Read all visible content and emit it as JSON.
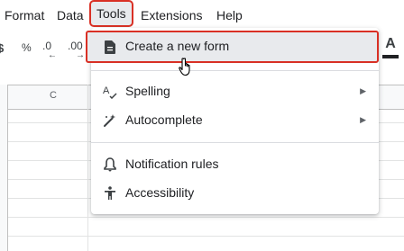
{
  "menubar": {
    "items": [
      {
        "label": "Format"
      },
      {
        "label": "Data"
      },
      {
        "label": "Tools"
      },
      {
        "label": "Extensions"
      },
      {
        "label": "Help"
      }
    ]
  },
  "toolbar": {
    "percent": "%",
    "decrease_decimal": ".0",
    "increase_decimal": ".00",
    "font_color_letter": "A"
  },
  "sheet": {
    "column_label": "C"
  },
  "tools_menu": {
    "create_form": "Create a new form",
    "spelling": "Spelling",
    "autocomplete": "Autocomplete",
    "notification_rules": "Notification rules",
    "accessibility": "Accessibility"
  },
  "colors": {
    "highlight_outline": "#d93025",
    "highlight_fill": "#e8eaed"
  }
}
